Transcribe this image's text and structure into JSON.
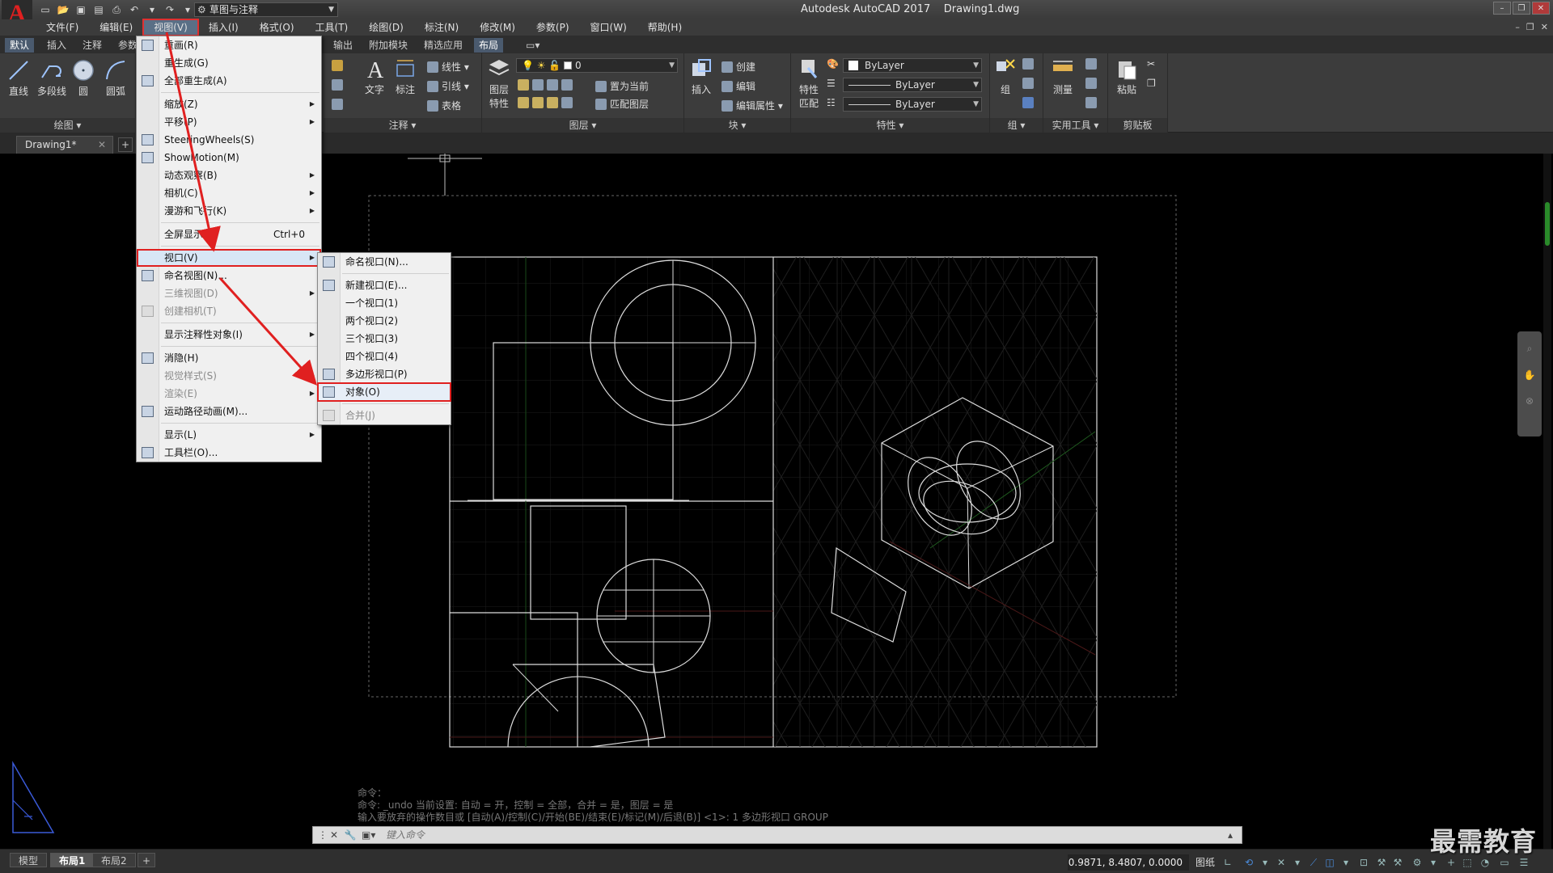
{
  "title_bar": {
    "workspace": "草图与注释",
    "app_name": "Autodesk AutoCAD 2017",
    "file_name": "Drawing1.dwg",
    "logo_letter": "A"
  },
  "menu_bar": {
    "items": [
      "文件(F)",
      "编辑(E)",
      "视图(V)",
      "插入(I)",
      "格式(O)",
      "工具(T)",
      "绘图(D)",
      "标注(N)",
      "修改(M)",
      "参数(P)",
      "窗口(W)",
      "帮助(H)"
    ]
  },
  "ribbon_tabs": {
    "items": [
      "默认",
      "插入",
      "注释",
      "参数",
      "输出",
      "附加模块",
      "精选应用",
      "布局"
    ]
  },
  "ribbon": {
    "draw": {
      "line": "直线",
      "polyline": "多段线",
      "circle": "圆",
      "arc": "圆弧",
      "label": "绘图"
    },
    "annotation": {
      "text": "文字",
      "dim": "标注",
      "linear": "线性",
      "leader": "引线",
      "table": "表格",
      "label": "注释"
    },
    "layers": {
      "layer_props_1": "图层",
      "layer_props_2": "特性",
      "current_layer": "0",
      "set_current": "置为当前",
      "match_layer": "匹配图层",
      "label": "图层"
    },
    "block": {
      "insert": "插入",
      "create": "创建",
      "edit": "编辑",
      "edit_attr": "编辑属性",
      "label": "块"
    },
    "properties": {
      "match_1": "特性",
      "match_2": "匹配",
      "color": "ByLayer",
      "linetype": "ByLayer",
      "lineweight": "ByLayer",
      "label": "特性"
    },
    "group": {
      "group": "组",
      "label": "组"
    },
    "utilities": {
      "measure": "测量",
      "label": "实用工具"
    },
    "clipboard": {
      "paste": "粘贴",
      "label": "剪贴板"
    }
  },
  "doc_tab": {
    "name": "Drawing1*"
  },
  "view_menu": {
    "items": [
      {
        "label": "重画(R)",
        "icon": "pencil-icon"
      },
      {
        "label": "重生成(G)"
      },
      {
        "label": "全部重生成(A)",
        "icon": "regen-all-icon"
      },
      {
        "sep": true
      },
      {
        "label": "缩放(Z)",
        "sub": true
      },
      {
        "label": "平移(P)",
        "sub": true
      },
      {
        "label": "SteeringWheels(S)",
        "icon": "wheel-icon"
      },
      {
        "label": "ShowMotion(M)",
        "icon": "showmotion-icon"
      },
      {
        "label": "动态观察(B)",
        "sub": true
      },
      {
        "label": "相机(C)",
        "sub": true
      },
      {
        "label": "漫游和飞行(K)",
        "sub": true
      },
      {
        "sep": true
      },
      {
        "label": "全屏显示(C)",
        "shortcut": "Ctrl+0"
      },
      {
        "sep": true
      },
      {
        "label": "视口(V)",
        "sub": true,
        "highlight": true
      },
      {
        "label": "命名视图(N)...",
        "icon": "named-view-icon"
      },
      {
        "label": "三维视图(D)",
        "sub": true,
        "disabled": true
      },
      {
        "label": "创建相机(T)",
        "icon": "camera-icon",
        "disabled": true
      },
      {
        "sep": true
      },
      {
        "label": "显示注释性对象(I)",
        "sub": true
      },
      {
        "sep": true
      },
      {
        "label": "消隐(H)",
        "icon": "hide-icon"
      },
      {
        "label": "视觉样式(S)",
        "sub": true,
        "disabled": true
      },
      {
        "label": "渲染(E)",
        "sub": true,
        "disabled": true
      },
      {
        "label": "运动路径动画(M)...",
        "icon": "film-icon"
      },
      {
        "sep": true
      },
      {
        "label": "显示(L)",
        "sub": true
      },
      {
        "label": "工具栏(O)...",
        "icon": "toolbar-icon"
      }
    ]
  },
  "viewport_submenu": {
    "items": [
      {
        "label": "命名视口(N)...",
        "icon": "named-viewport-icon"
      },
      {
        "sep": true
      },
      {
        "label": "新建视口(E)...",
        "icon": "new-viewport-icon"
      },
      {
        "label": "一个视口(1)"
      },
      {
        "label": "两个视口(2)"
      },
      {
        "label": "三个视口(3)"
      },
      {
        "label": "四个视口(4)"
      },
      {
        "label": "多边形视口(P)",
        "icon": "polygon-viewport-icon"
      },
      {
        "label": "对象(O)",
        "icon": "object-viewport-icon",
        "outlined": true
      },
      {
        "sep": true
      },
      {
        "label": "合并(J)",
        "icon": "join-viewport-icon",
        "disabled": true
      }
    ]
  },
  "command_line": {
    "history": [
      "命令：",
      "命令: _undo 当前设置: 自动 = 开，控制 = 全部，合并 = 是，图层 = 是",
      "输入要放弃的操作数目或 [自动(A)/控制(C)/开始(BE)/结束(E)/标记(M)/后退(B)] <1>: 1 多边形视口 GROUP"
    ],
    "placeholder": "键入命令"
  },
  "status_bar": {
    "layout_tabs": [
      "模型",
      "布局1",
      "布局2"
    ],
    "active_layout": "布局1",
    "coords": "0.9871, 8.4807, 0.0000",
    "paper": "图纸"
  },
  "watermark": "最需教育",
  "colors": {
    "accent_red": "#e02020",
    "canvas": "#000000",
    "ribbon": "#3c3c3c",
    "menu_bg": "#f0f0f0"
  }
}
